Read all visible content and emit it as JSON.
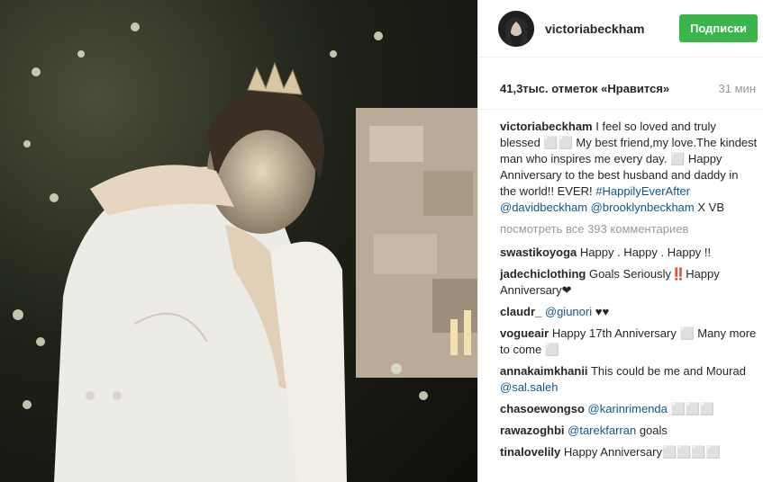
{
  "post": {
    "username": "victoriabeckham",
    "follow_label": "Подписки",
    "likes": "41,3тыс. отметок «Нравится»",
    "time": "31 мин",
    "caption": {
      "author": "victoriabeckham",
      "text1": "I feel so loved and truly blessed ⬜⬜ My best friend,my love.The kindest man who inspires me every day. ⬜ Happy Anniversary to the best husband and daddy in the world!! EVER!",
      "hashtag": "#HappilyEverAfter",
      "mention1": "@davidbeckham",
      "mention2": "@brooklynbeckham",
      "sign": "X VB"
    },
    "view_all": "посмотреть все 393 комментариев"
  },
  "comments": [
    {
      "user": "swastikoyoga",
      "text": "Happy . Happy . Happy !!"
    },
    {
      "user": "jadechiclothing",
      "text": "Goals Seriously‼️Happy Anniversary❤"
    },
    {
      "user": "claudr_",
      "mention": "@giunori",
      "text": "♥♥"
    },
    {
      "user": "vogueair",
      "text": "Happy 17th Anniversary ⬜ Many more to come ⬜"
    },
    {
      "user": "annakaimkhanii",
      "text": "This could be me and Mourad",
      "mention": "@sal.saleh"
    },
    {
      "user": "chasoewongso",
      "mention": "@karinrimenda",
      "text": "⬜⬜⬜"
    },
    {
      "user": "rawazoghbi",
      "mention": "@tarekfarran",
      "text": "goals"
    },
    {
      "user": "tinalovelily",
      "text": "Happy Anniversary⬜⬜⬜⬜"
    }
  ]
}
